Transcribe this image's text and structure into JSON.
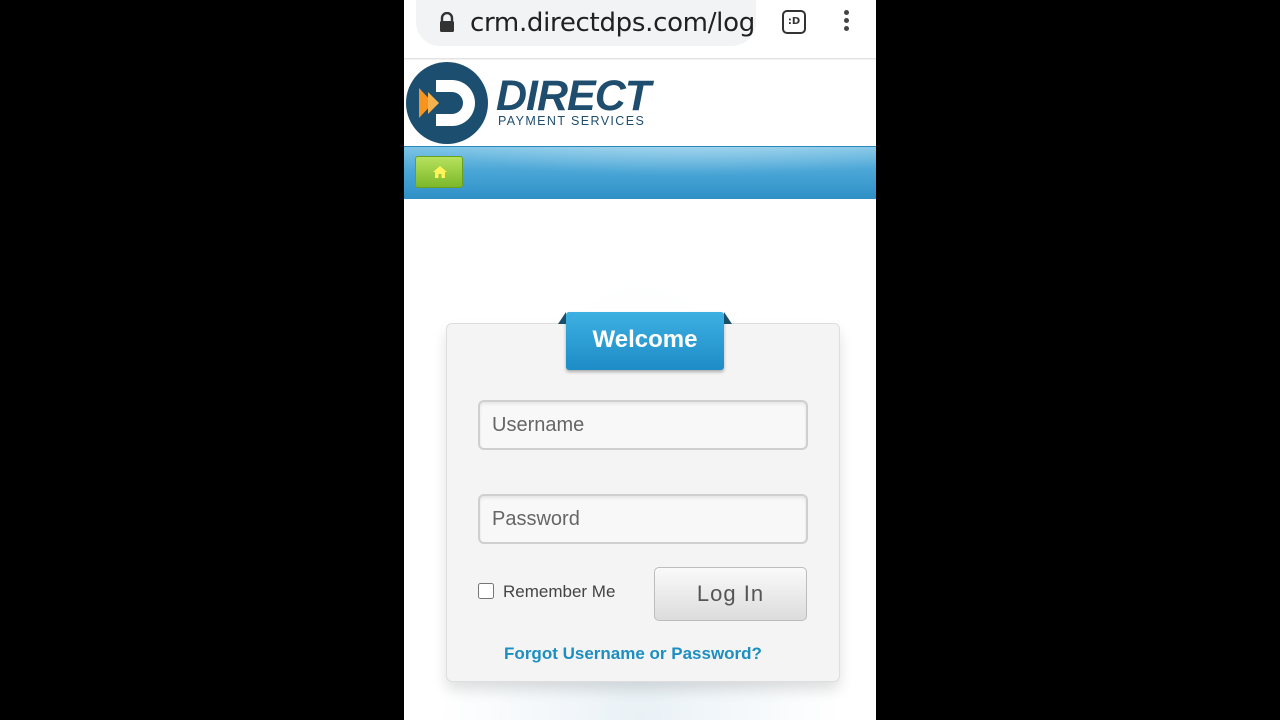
{
  "browser": {
    "url": "crm.directdps.com/login",
    "tab_switcher_label": ":D"
  },
  "brand": {
    "name": "DIRECT",
    "tagline": "PAYMENT SERVICES"
  },
  "nav": {
    "home_icon": "home-icon"
  },
  "login": {
    "welcome": "Welcome",
    "username_placeholder": "Username",
    "password_placeholder": "Password",
    "remember_label": "Remember Me",
    "login_button": "Log In",
    "forgot_link": "Forgot Username or Password?"
  },
  "colors": {
    "nav_blue": "#3a9fd2",
    "welcome_blue": "#1e8cc6",
    "brand_navy": "#1f4d6e",
    "home_green": "#8cc63f",
    "link_blue": "#1d8ec0"
  }
}
